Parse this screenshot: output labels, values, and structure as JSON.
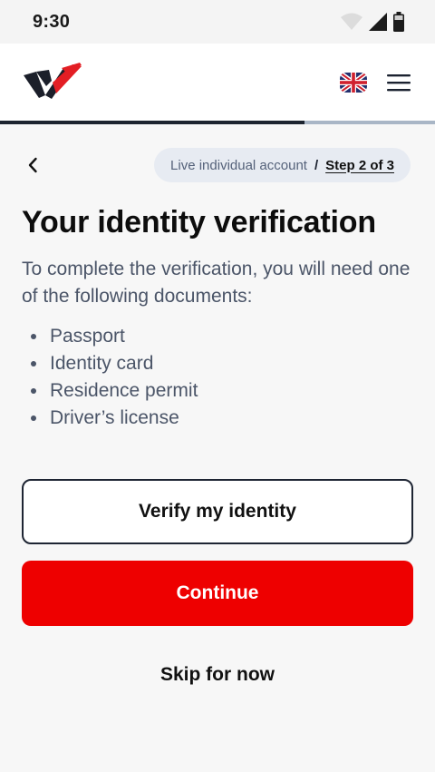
{
  "status_bar": {
    "time": "9:30",
    "icons": [
      "wifi-icon",
      "cellular-signal-icon",
      "battery-icon"
    ]
  },
  "header": {
    "logo": "brand-logo",
    "language_icon": "uk-flag-icon",
    "menu_icon": "hamburger-menu-icon"
  },
  "progress": {
    "fraction": 0.7
  },
  "breadcrumb": {
    "account_type": "Live individual account",
    "separator": "/",
    "step": "Step 2 of 3"
  },
  "content": {
    "title": "Your identity verification",
    "description": "To complete the verification, you will need one of the following documents:",
    "documents": [
      "Passport",
      "Identity card",
      "Residence permit",
      "Driver’s license"
    ]
  },
  "actions": {
    "verify_label": "Verify my identity",
    "continue_label": "Continue",
    "skip_label": "Skip for now"
  },
  "colors": {
    "accent": "#ee0000",
    "dark": "#1d2430",
    "progress_track": "#a9b6c6",
    "pill_bg": "#e7ebf2"
  }
}
